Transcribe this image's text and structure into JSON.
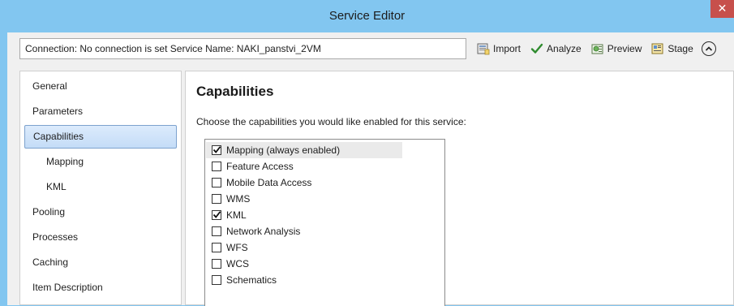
{
  "window": {
    "title": "Service Editor"
  },
  "connection": {
    "text": "Connection: No connection is set   Service Name: NAKI_panstvi_2VM"
  },
  "toolbar": {
    "import_label": "Import",
    "analyze_label": "Analyze",
    "preview_label": "Preview",
    "stage_label": "Stage"
  },
  "nav": {
    "items": [
      {
        "label": "General",
        "sub": false,
        "selected": false
      },
      {
        "label": "Parameters",
        "sub": false,
        "selected": false
      },
      {
        "label": "Capabilities",
        "sub": false,
        "selected": true
      },
      {
        "label": "Mapping",
        "sub": true,
        "selected": false
      },
      {
        "label": "KML",
        "sub": true,
        "selected": false
      },
      {
        "label": "Pooling",
        "sub": false,
        "selected": false
      },
      {
        "label": "Processes",
        "sub": false,
        "selected": false
      },
      {
        "label": "Caching",
        "sub": false,
        "selected": false
      },
      {
        "label": "Item Description",
        "sub": false,
        "selected": false
      }
    ]
  },
  "panel": {
    "title": "Capabilities",
    "description": "Choose the capabilities you would like enabled for this service:",
    "capabilities": [
      {
        "label": "Mapping (always enabled)",
        "checked": true
      },
      {
        "label": "Feature Access",
        "checked": false
      },
      {
        "label": "Mobile Data Access",
        "checked": false
      },
      {
        "label": "WMS",
        "checked": false
      },
      {
        "label": "KML",
        "checked": true
      },
      {
        "label": "Network Analysis",
        "checked": false
      },
      {
        "label": "WFS",
        "checked": false
      },
      {
        "label": "WCS",
        "checked": false
      },
      {
        "label": "Schematics",
        "checked": false
      }
    ]
  },
  "colors": {
    "titlebar": "#82c6f0",
    "close": "#c7504c",
    "selection": "#c4dcf7",
    "analyze_check": "#2e8b2e"
  }
}
